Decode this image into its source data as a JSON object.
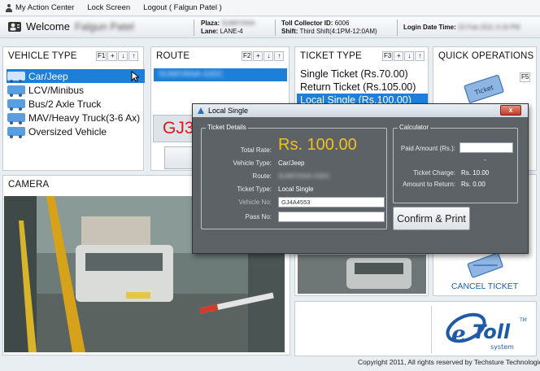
{
  "menu": {
    "items": [
      "My Action Center",
      "Lock Screen",
      "Logout ( Falgun Patel )"
    ]
  },
  "header": {
    "welcome_label": "Welcome",
    "welcome_name": "Falgun Patel",
    "plaza_label": "Plaza:",
    "plaza_value": "SUMIYANA",
    "lane_label": "Lane:",
    "lane_value": "LANE-4",
    "collector_label": "Toll Collector ID:",
    "collector_value": "6006",
    "shift_label": "Shift:",
    "shift_value": "Third Shift(4:1PM-12:0AM)",
    "login_label": "Login Date Time:",
    "login_value": "23 Feb 2011 4:19 PM"
  },
  "vehicle_type": {
    "title": "VEHICLE TYPE",
    "hotkey": "F1",
    "items": [
      "Car/Jeep",
      "LCV/Minibus",
      "Bus/2 Axle Truck",
      "MAV/Heavy Truck(3-6 Ax)",
      "Oversized Vehicle"
    ],
    "selected_index": 0
  },
  "route": {
    "title": "ROUTE",
    "hotkey": "F2",
    "selected": "SUMIYANA-GIDC",
    "plate_partial": "GJ3"
  },
  "ticket_type": {
    "title": "TICKET TYPE",
    "hotkey": "F3",
    "items": [
      "Single Ticket (Rs.70.00)",
      "Return Ticket (Rs.105.00)",
      "Local Single   (Rs.100.00)"
    ],
    "selected_index": 2
  },
  "quick_ops": {
    "title": "QUICK OPERATIONS",
    "hotkey": "F5",
    "ticket_icon_text": "Ticket",
    "cancel_label": "CANCEL TICKET"
  },
  "camera": {
    "title": "CAMERA"
  },
  "dialog": {
    "title": "Local Single",
    "close": "x",
    "details_group": "Ticket Details",
    "total_rate_label": "Total Rate:",
    "total_rate_value": "Rs. 100.00",
    "vehicle_type_label": "Vehicle Type:",
    "vehicle_type_value": "Car/Jeep",
    "route_label": "Route:",
    "route_value": "SUMIYANA-GIDC",
    "ticket_type_label": "Ticket Type:",
    "ticket_type_value": "Local Single",
    "vehicle_no_label": "Vehicle No:",
    "vehicle_no_value": "GJ4A4553",
    "pass_no_label": "Pass No:",
    "pass_no_value": "",
    "calculator_group": "Calculator",
    "paid_amount_label": "Paid Amount (Rs.):",
    "paid_amount_value": "",
    "dash": "-",
    "ticket_charge_label": "Ticket Charge:",
    "ticket_charge_value": "Rs. 10.00",
    "amount_return_label": "Amount to Return:",
    "amount_return_value": "Rs. 0.00",
    "confirm_label": "Confirm & Print"
  },
  "logo": {
    "brand": "Toll",
    "sub": "system",
    "tm": "TM"
  },
  "footer": {
    "copyright": "Copyright 2011, All rights reserved  by Techsture Technologies"
  },
  "colors": {
    "accent": "#1e7fd8",
    "amount": "#f2c21b",
    "plate_red": "#d71a1a",
    "cancel_text": "#1a5fa8"
  }
}
